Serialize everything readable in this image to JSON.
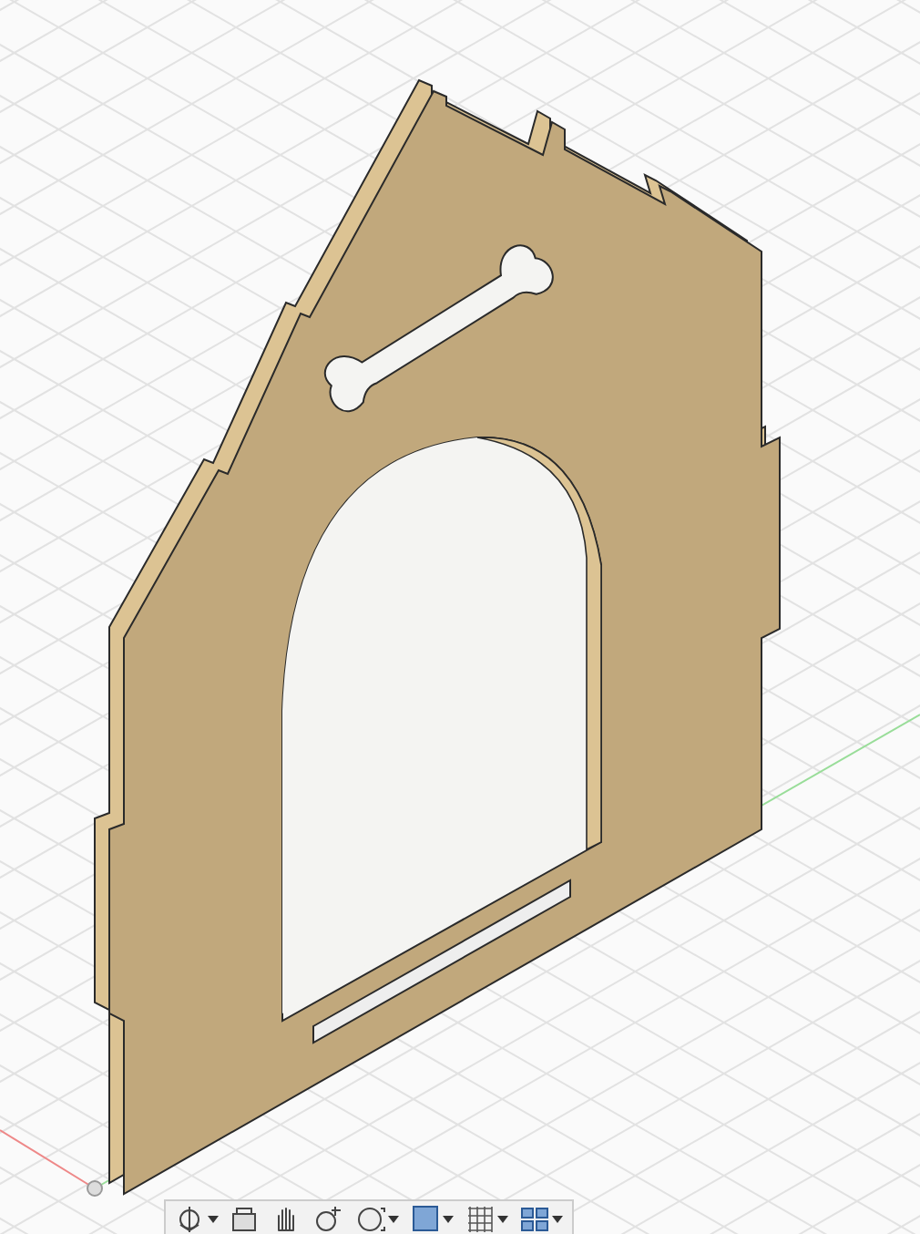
{
  "viewport": {
    "toolbar": {
      "tools": [
        {
          "kind": "orbit",
          "menu": true
        },
        {
          "kind": "look",
          "menu": false
        },
        {
          "kind": "pan",
          "menu": false
        },
        {
          "kind": "zoom",
          "menu": false
        },
        {
          "kind": "fit",
          "menu": true
        },
        {
          "kind": "display",
          "menu": true
        },
        {
          "kind": "grid",
          "menu": true
        },
        {
          "kind": "views",
          "menu": true
        }
      ]
    }
  }
}
